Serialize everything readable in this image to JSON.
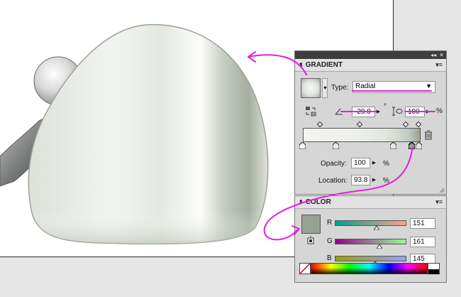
{
  "gradient_panel": {
    "title": "GRADIENT",
    "type_label": "Type:",
    "type_value": "Radial",
    "angle_value": "-29.0",
    "angle_degree_mark": "°",
    "aspect_value": "100",
    "aspect_unit": "%",
    "opacity_label": "Opacity:",
    "opacity_value": "100",
    "opacity_unit": "%",
    "location_label": "Location:",
    "location_value": "93.8",
    "location_unit": "%"
  },
  "color_panel": {
    "title": "COLOR",
    "r_label": "R",
    "r_value": "151",
    "g_label": "G",
    "g_value": "161",
    "b_label": "B",
    "b_value": "145",
    "fill_color": "#97a191"
  },
  "colors": {
    "annotation": "#e020e0",
    "panel_bg": "#d6d6d6",
    "panel_titlebar": "#3d3d3d"
  },
  "icons": [
    "collapse-arrows-icon",
    "close-icon",
    "panel-menu-icon",
    "reverse-gradient-icon",
    "angle-icon",
    "aspect-ratio-icon",
    "trash-icon",
    "no-fill-icon"
  ]
}
